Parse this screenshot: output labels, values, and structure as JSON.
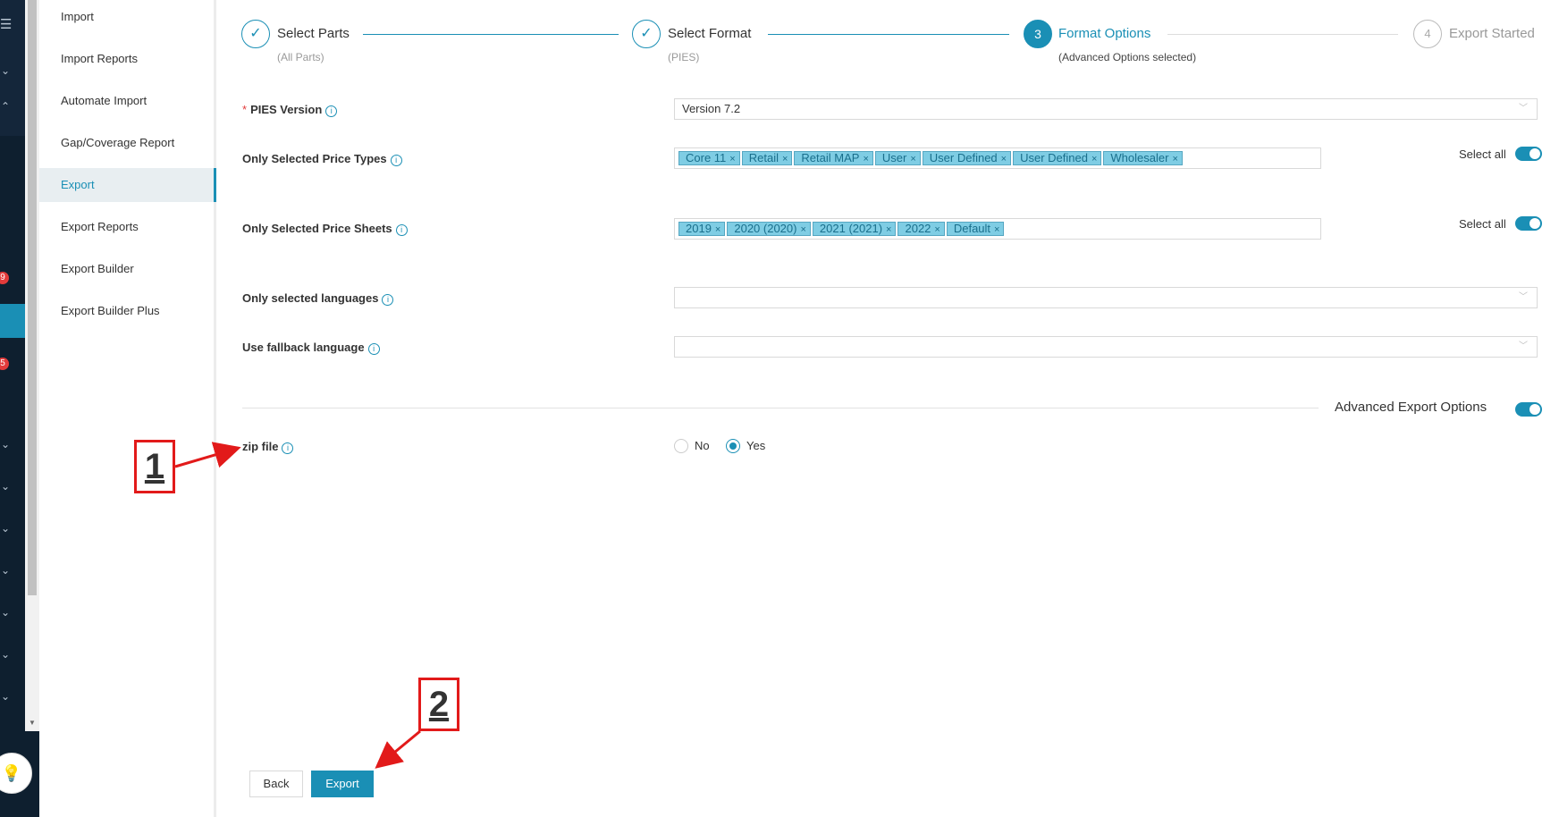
{
  "rail": {
    "menu_glyph": "☰",
    "badge_top": "9",
    "badge_bottom": "5",
    "bulb_icon": "lightbulb-icon"
  },
  "subnav": {
    "items": [
      {
        "label": "Import"
      },
      {
        "label": "Import Reports"
      },
      {
        "label": "Automate Import"
      },
      {
        "label": "Gap/Coverage Report"
      },
      {
        "label": "Export"
      },
      {
        "label": "Export Reports"
      },
      {
        "label": "Export Builder"
      },
      {
        "label": "Export Builder Plus"
      }
    ],
    "active": "Export"
  },
  "steps": [
    {
      "number": "✓",
      "title": "Select Parts",
      "subtitle": "(All Parts)",
      "state": "done"
    },
    {
      "number": "✓",
      "title": "Select Format",
      "subtitle": "(PIES)",
      "state": "done"
    },
    {
      "number": "3",
      "title": "Format Options",
      "subtitle": "(Advanced Options selected)",
      "state": "active"
    },
    {
      "number": "4",
      "title": "Export Started",
      "subtitle": "",
      "state": "todo"
    }
  ],
  "form": {
    "pies_version": {
      "required_mark": "*",
      "label": "PIES Version",
      "value": "Version 7.2"
    },
    "price_types": {
      "label": "Only Selected Price Types",
      "tags": [
        "Core 11",
        "Retail",
        "Retail MAP",
        "User",
        "User Defined",
        "User Defined",
        "Wholesaler"
      ],
      "select_all_label": "Select all",
      "select_all_on": true
    },
    "price_sheets": {
      "label": "Only Selected Price Sheets",
      "tags": [
        "2019",
        "2020 (2020)",
        "2021 (2021)",
        "2022",
        "Default"
      ],
      "select_all_label": "Select all",
      "select_all_on": true
    },
    "languages": {
      "label": "Only selected languages",
      "value": ""
    },
    "fallback_language": {
      "label": "Use fallback language",
      "value": ""
    },
    "advanced_export_options": {
      "label": "Advanced Export Options",
      "on": true
    },
    "zip_file": {
      "label": "zip file",
      "options": [
        "No",
        "Yes"
      ],
      "selected": "Yes"
    }
  },
  "tag_remove_glyph": "×",
  "info_glyph": "i",
  "chevron_glyph": "﹀",
  "buttons": {
    "back": "Back",
    "export": "Export"
  },
  "annotations": [
    {
      "number": "1",
      "points_to": "zip file"
    },
    {
      "number": "2",
      "points_to": "Export button"
    }
  ],
  "colors": {
    "accent": "#1a8fb5",
    "annotation": "#e21a1a",
    "rail": "#0e1f2f"
  }
}
